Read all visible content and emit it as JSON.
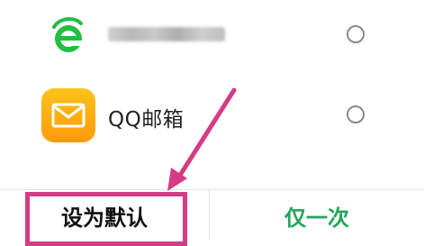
{
  "chooser": {
    "options": [
      {
        "icon": "green-e-browser-icon",
        "label": "",
        "label_blurred": true,
        "selected": false
      },
      {
        "icon": "qq-mail-icon",
        "label": "QQ邮箱",
        "selected": false
      }
    ],
    "buttons": {
      "set_default": "设为默认",
      "just_once": "仅一次"
    }
  },
  "colors": {
    "accent_green": "#22a55a",
    "annotation_pink": "#d43c86",
    "mail_icon_orange": "#ffb012"
  }
}
